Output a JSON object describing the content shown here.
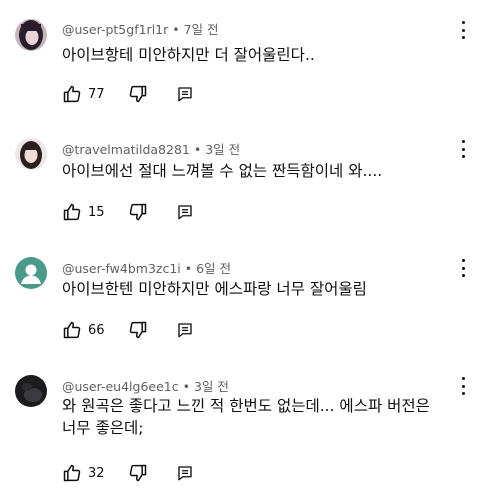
{
  "comments": [
    {
      "author": "@user-pt5gf1rl1r",
      "time": "7일 전",
      "text": "아이브항테 미안하지만 더 잘어울린다..",
      "likes": "77",
      "avatar_colors": [
        "#2a1e2c",
        "#d9c2c8"
      ],
      "avatar_icon": "profile-photo"
    },
    {
      "author": "@travelmatilda8281",
      "time": "3일 전",
      "text": "아이브에선 절대 느껴볼 수 없는 짠득함이네 와....",
      "likes": "15",
      "avatar_colors": [
        "#2b2020",
        "#f0dcd3"
      ],
      "avatar_icon": "profile-photo"
    },
    {
      "author": "@user-fw4bm3zc1i",
      "time": "6일 전",
      "text": "아이브한텐 미안하지만 에스파랑 너무 잘어울림",
      "likes": "66",
      "avatar_colors": [
        "#4a9a8a",
        "#ffffff"
      ],
      "avatar_icon": "default-person-icon"
    },
    {
      "author": "@user-eu4lg6ee1c",
      "time": "3일 전",
      "text": "와 원곡은 좋다고 느낀 적 한번도 없는데... 에스파 버전은 너무 좋은데;",
      "likes": "32",
      "avatar_colors": [
        "#1c1c1f",
        "#3a3a40"
      ],
      "avatar_icon": "profile-photo"
    }
  ],
  "separator": " • "
}
